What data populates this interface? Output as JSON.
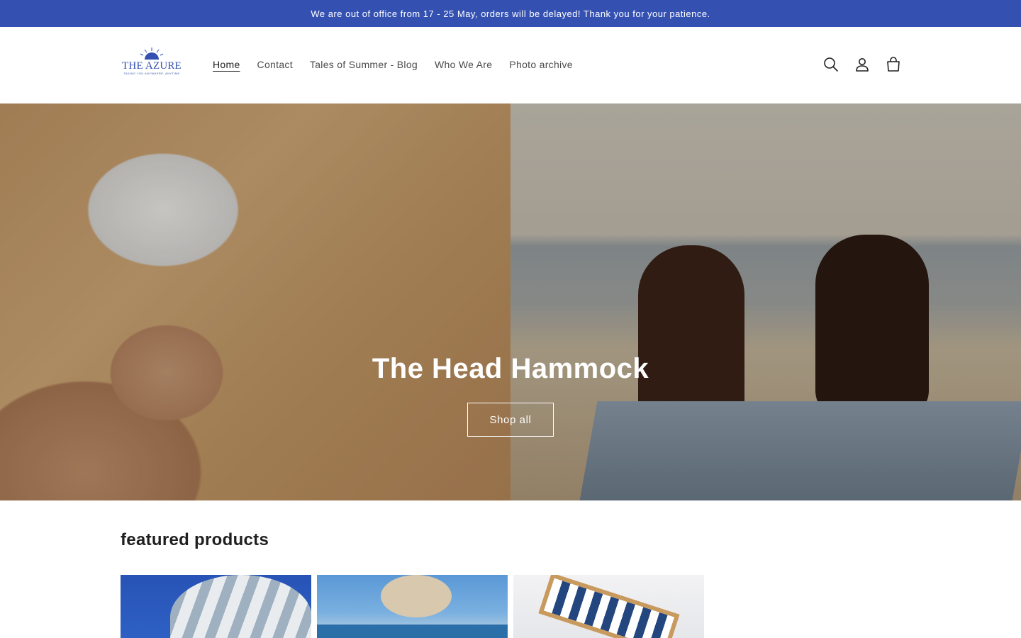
{
  "announcement": {
    "text": "We are out of office from 17 - 25 May, orders will be delayed! Thank you for your patience."
  },
  "header": {
    "logo": {
      "name": "THE AZURE",
      "tagline": "taking you anywhere, anytime"
    },
    "nav": [
      {
        "label": "Home",
        "active": true
      },
      {
        "label": "Contact"
      },
      {
        "label": "Tales of Summer - Blog"
      },
      {
        "label": "Who We Are"
      },
      {
        "label": "Photo archive"
      }
    ],
    "icons": [
      "search-icon",
      "account-icon",
      "cart-icon"
    ]
  },
  "hero": {
    "title": "The Head Hammock",
    "button_label": "Shop all"
  },
  "featured": {
    "title": "featured products"
  },
  "colors": {
    "brand": "#3451b2",
    "text": "#1f1f1f"
  }
}
